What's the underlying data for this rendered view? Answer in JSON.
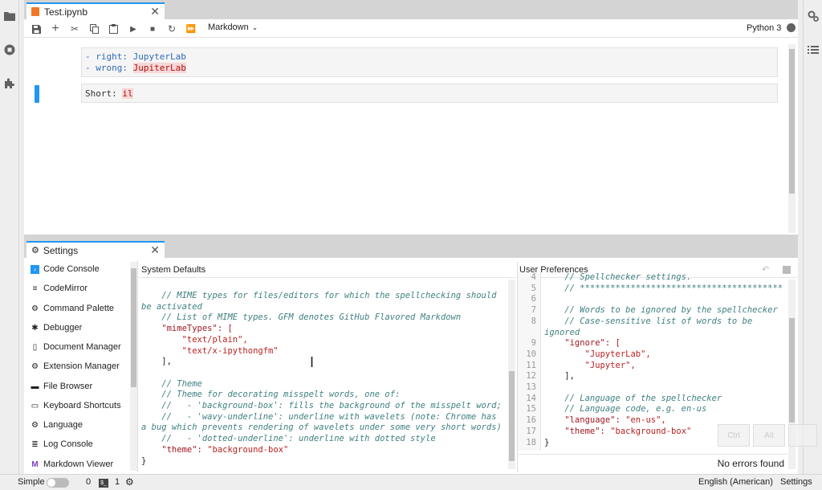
{
  "notebook": {
    "tab_title": "Test.ipynb",
    "cell_type": "Markdown",
    "kernel": "Python 3",
    "cell1_lines": [
      {
        "prefix": "- right: ",
        "word": "JupyterLab"
      },
      {
        "prefix": "- wrong: ",
        "word": "JupiterLab"
      }
    ],
    "cell2": {
      "prefix": "Short: ",
      "word": "il"
    }
  },
  "settings": {
    "tab_title": "Settings",
    "plugins": [
      "Code Console",
      "CodeMirror",
      "Command Palette",
      "Debugger",
      "Document Manager",
      "Extension Manager",
      "File Browser",
      "Keyboard Shortcuts",
      "Language",
      "Log Console",
      "Markdown Viewer"
    ],
    "system_defaults_label": "System Defaults",
    "user_preferences_label": "User Preferences",
    "system_lines": [
      {
        "t": "c",
        "s": "    // MIME types for files/editors for which the spellchecking should"
      },
      {
        "t": "c",
        "s": "be activated"
      },
      {
        "t": "c",
        "s": "    // List of MIME types. GFM denotes GitHub Flavored Markdown"
      },
      {
        "t": "k",
        "s": "    \"mimeTypes\": ["
      },
      {
        "t": "s",
        "s": "        \"text/plain\","
      },
      {
        "t": "s",
        "s": "        \"text/x-ipythongfm\""
      },
      {
        "t": "p",
        "s": "    ],"
      },
      {
        "t": "p",
        "s": ""
      },
      {
        "t": "c",
        "s": "    // Theme"
      },
      {
        "t": "c",
        "s": "    // Theme for decorating misspelt words, one of:"
      },
      {
        "t": "c",
        "s": "    //   - 'background-box': fills the background of the misspelt word;"
      },
      {
        "t": "c",
        "s": "    //   - 'wavy-underline': underline with wavelets (note: Chrome has"
      },
      {
        "t": "c",
        "s": "a bug which prevents rendering of wavelets under some very short words)"
      },
      {
        "t": "c",
        "s": "    //   - 'dotted-underline': underline with dotted style"
      },
      {
        "t": "kv",
        "k": "    \"theme\": ",
        "v": "\"background-box\""
      },
      {
        "t": "p",
        "s": "}"
      }
    ],
    "user_line_numbers": [
      "4",
      "5",
      "6",
      "7",
      "8",
      "",
      "9",
      "10",
      "11",
      "12",
      "13",
      "14",
      "15",
      "16",
      "17",
      "18"
    ],
    "user_lines": [
      {
        "t": "c",
        "s": "    // Spellchecker settings."
      },
      {
        "t": "c",
        "s": "    // ****************************************"
      },
      {
        "t": "p",
        "s": ""
      },
      {
        "t": "c",
        "s": "    // Words to be ignored by the spellchecker"
      },
      {
        "t": "c",
        "s": "    // Case-sensitive list of words to be"
      },
      {
        "t": "c",
        "s": "ignored"
      },
      {
        "t": "k",
        "s": "    \"ignore\": ["
      },
      {
        "t": "s",
        "s": "        \"JupyterLab\","
      },
      {
        "t": "s",
        "s": "        \"Jupyter\","
      },
      {
        "t": "p",
        "s": "    ],"
      },
      {
        "t": "p",
        "s": ""
      },
      {
        "t": "c",
        "s": "    // Language of the spellchecker"
      },
      {
        "t": "c",
        "s": "    // Language code, e.g. en-us"
      },
      {
        "t": "kv",
        "k": "    \"language\": ",
        "v": "\"en-us\","
      },
      {
        "t": "kv",
        "k": "    \"theme\": ",
        "v": "\"background-box\""
      },
      {
        "t": "p",
        "s": "}"
      }
    ],
    "status_text": "No errors found"
  },
  "overlay_keys": [
    "Ctrl",
    "Alt",
    ""
  ],
  "statusbar": {
    "mode_label": "Simple",
    "terminals_count": "0",
    "kernels_count": "1",
    "language": "English (American)",
    "settings_label": "Settings"
  },
  "colors": {
    "accent": "#2196f3",
    "misspelt_bg": "#f7d7d7",
    "comment": "#408080",
    "string": "#ba2121"
  }
}
